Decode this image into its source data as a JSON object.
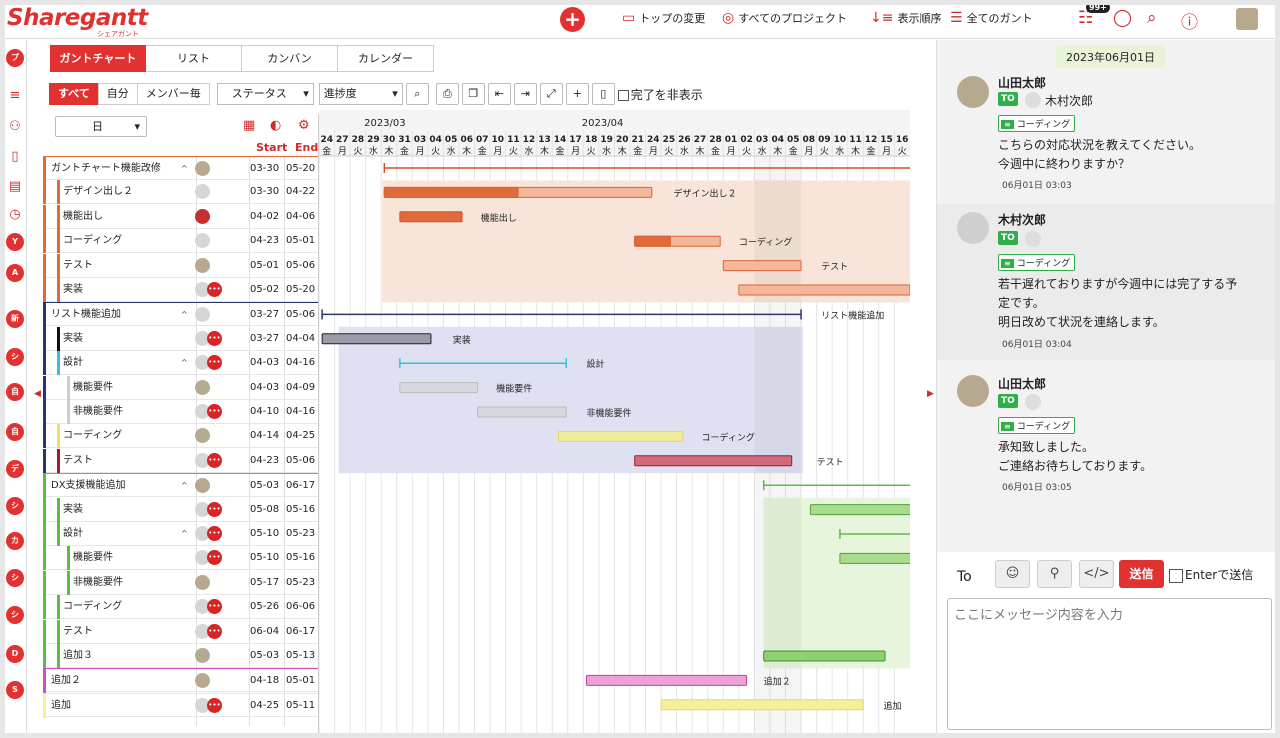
{
  "app": {
    "logo": "Sharegantt",
    "logo_sub": "シェアガント"
  },
  "header": {
    "add": "+",
    "nav": [
      {
        "label": "トップの変更",
        "icon": "monitor-icon"
      },
      {
        "label": "すべてのプロジェクト",
        "icon": "projects-icon"
      },
      {
        "label": "表示順序",
        "icon": "sort-icon"
      },
      {
        "label": "全てのガント",
        "icon": "gantt-list-icon"
      }
    ],
    "badge": "99+"
  },
  "rail": {
    "top_icons": [
      "menu-icon",
      "users-icon",
      "file-icon",
      "book-icon",
      "history-icon",
      "gear-icon"
    ],
    "top_dot": "プ",
    "dots": [
      "Y",
      "A",
      "新",
      "シ",
      "自",
      "自",
      "デ",
      "シ",
      "カ",
      "シ",
      "シ",
      "D",
      "S"
    ]
  },
  "tabs": [
    "ガントチャート",
    "リスト",
    "カンバン",
    "カレンダー"
  ],
  "toolbar": {
    "filters": [
      "すべて",
      "自分",
      "メンバー毎"
    ],
    "status": "ステータス",
    "progress": "進捗度",
    "hide_done": "完了を非表示"
  },
  "tasklist": {
    "scale": "日",
    "start_col": "Start",
    "end_col": "End",
    "rows": [
      {
        "name": "ガントチャート機能改修",
        "start": "03-30",
        "end": "05-20"
      },
      {
        "name": "デザイン出し２",
        "start": "03-30",
        "end": "04-22"
      },
      {
        "name": "機能出し",
        "start": "04-02",
        "end": "04-06"
      },
      {
        "name": "コーディング",
        "start": "04-23",
        "end": "05-01"
      },
      {
        "name": "テスト",
        "start": "05-01",
        "end": "05-06"
      },
      {
        "name": "実装",
        "start": "05-02",
        "end": "05-20"
      },
      {
        "name": "リスト機能追加",
        "start": "03-27",
        "end": "05-06"
      },
      {
        "name": "実装",
        "start": "03-27",
        "end": "04-04"
      },
      {
        "name": "設計",
        "start": "04-03",
        "end": "04-16"
      },
      {
        "name": "機能要件",
        "start": "04-03",
        "end": "04-09"
      },
      {
        "name": "非機能要件",
        "start": "04-10",
        "end": "04-16"
      },
      {
        "name": "コーディング",
        "start": "04-14",
        "end": "04-25"
      },
      {
        "name": "テスト",
        "start": "04-23",
        "end": "05-06"
      },
      {
        "name": "DX支援機能追加",
        "start": "05-03",
        "end": "06-17"
      },
      {
        "name": "実装",
        "start": "05-08",
        "end": "05-16"
      },
      {
        "name": "設計",
        "start": "05-10",
        "end": "05-23"
      },
      {
        "name": "機能要件",
        "start": "05-10",
        "end": "05-16"
      },
      {
        "name": "非機能要件",
        "start": "05-17",
        "end": "05-23"
      },
      {
        "name": "コーディング",
        "start": "05-26",
        "end": "06-06"
      },
      {
        "name": "テスト",
        "start": "06-04",
        "end": "06-17"
      },
      {
        "name": "追加３",
        "start": "05-03",
        "end": "05-13"
      },
      {
        "name": "追加２",
        "start": "04-18",
        "end": "05-01"
      },
      {
        "name": "追加",
        "start": "04-25",
        "end": "05-11"
      }
    ]
  },
  "gantt": {
    "months": [
      "2023/03",
      "2023/04"
    ],
    "days": [
      "24",
      "27",
      "28",
      "29",
      "30",
      "31",
      "03",
      "04",
      "05",
      "06",
      "07",
      "10",
      "11",
      "12",
      "13",
      "14",
      "17",
      "18",
      "19",
      "20",
      "21",
      "24",
      "25",
      "26",
      "27",
      "28",
      "01",
      "02",
      "03",
      "04",
      "05",
      "08",
      "09",
      "10",
      "11",
      "12",
      "15",
      "16"
    ],
    "weekdays": [
      "金",
      "月",
      "火",
      "水",
      "木",
      "金",
      "月",
      "火",
      "水",
      "木",
      "金",
      "月",
      "火",
      "水",
      "木",
      "金",
      "月",
      "火",
      "水",
      "木",
      "金",
      "月",
      "火",
      "水",
      "木",
      "金",
      "月",
      "火",
      "水",
      "木",
      "金",
      "月",
      "火",
      "水",
      "木",
      "金",
      "月",
      "火"
    ],
    "bar_labels": [
      "デザイン出し２",
      "機能出し",
      "コーディング",
      "テスト",
      "リスト機能追加",
      "実装",
      "設計",
      "機能要件",
      "非機能要件",
      "コーディング",
      "テスト",
      "追加２",
      "追加"
    ],
    "colors": {
      "red": "#e06a3a",
      "navy": "#2a3471",
      "green": "#5cbd45",
      "pink": "#f0a0d8",
      "yellow": "#f5ef9a"
    }
  },
  "chat": {
    "date": "2023年06月01日",
    "to_tag": "TO",
    "messages": [
      {
        "author": "山田太郎",
        "to": "木村次郎",
        "tag": "コーディング",
        "lines": [
          "こちらの対応状況を教えてください。",
          "今週中に終わりますか？"
        ],
        "time": "06月01日 03:03"
      },
      {
        "author": "木村次郎",
        "to": "",
        "tag": "コーディング",
        "lines": [
          "若干遅れておりますが今週中には完了する予",
          "定です。",
          "明日改めて状況を連絡します。"
        ],
        "time": "06月01日 03:04"
      },
      {
        "author": "山田太郎",
        "to": "",
        "tag": "コーディング",
        "lines": [
          "承知致しました。",
          "ご連絡お待ちしております。"
        ],
        "time": "06月01日 03:05"
      }
    ],
    "compose": {
      "to_label": "To",
      "send": "送信",
      "enter_send": "Enterで送信",
      "placeholder": "ここにメッセージ内容を入力"
    }
  }
}
